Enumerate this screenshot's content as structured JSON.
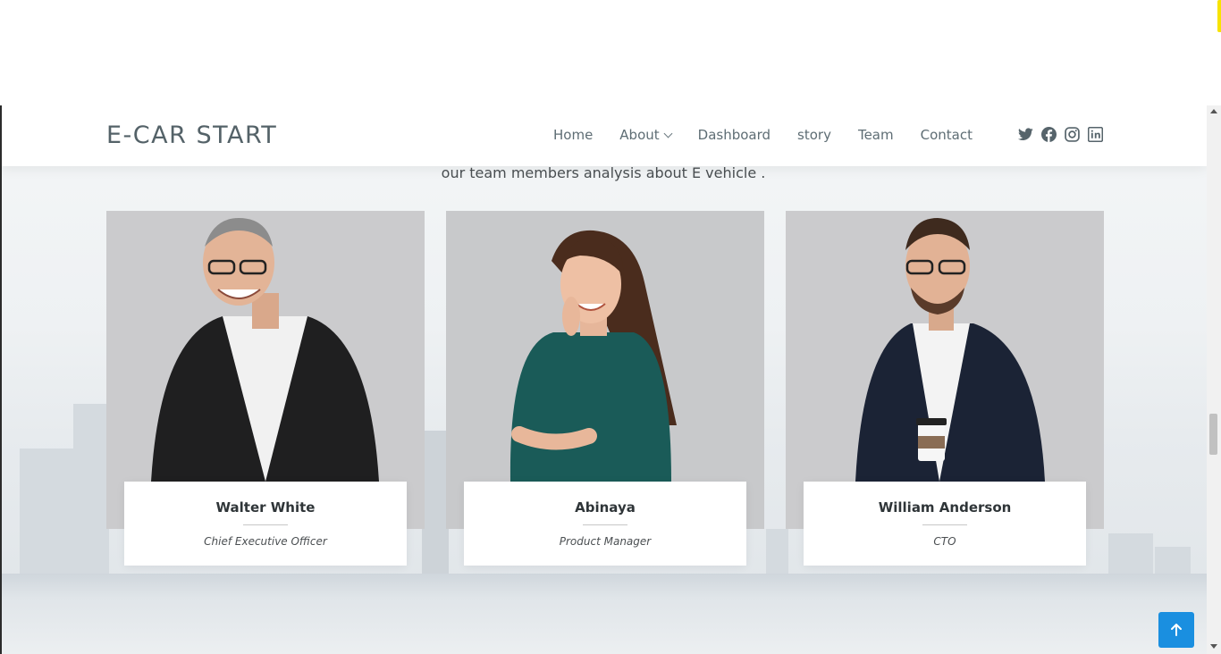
{
  "header": {
    "logo": "E-CAR START",
    "nav": [
      {
        "label": "Home",
        "has_dropdown": false
      },
      {
        "label": "About",
        "has_dropdown": true
      },
      {
        "label": "Dashboard",
        "has_dropdown": false
      },
      {
        "label": "story",
        "has_dropdown": false
      },
      {
        "label": "Team",
        "has_dropdown": false
      },
      {
        "label": "Contact",
        "has_dropdown": false
      }
    ],
    "social_icons": [
      "twitter-icon",
      "facebook-icon",
      "instagram-icon",
      "linkedin-icon"
    ]
  },
  "team": {
    "subtitle": "our team members analysis about E vehicle .",
    "members": [
      {
        "name": "Walter White",
        "role": "Chief Executive Officer"
      },
      {
        "name": "Abinaya",
        "role": "Product Manager"
      },
      {
        "name": "William Anderson",
        "role": "CTO"
      }
    ]
  },
  "colors": {
    "accent": "#1a8fe0",
    "nav_text": "#5e6d74",
    "logo_text": "#546268"
  },
  "back_to_top_icon": "arrow-up-icon"
}
